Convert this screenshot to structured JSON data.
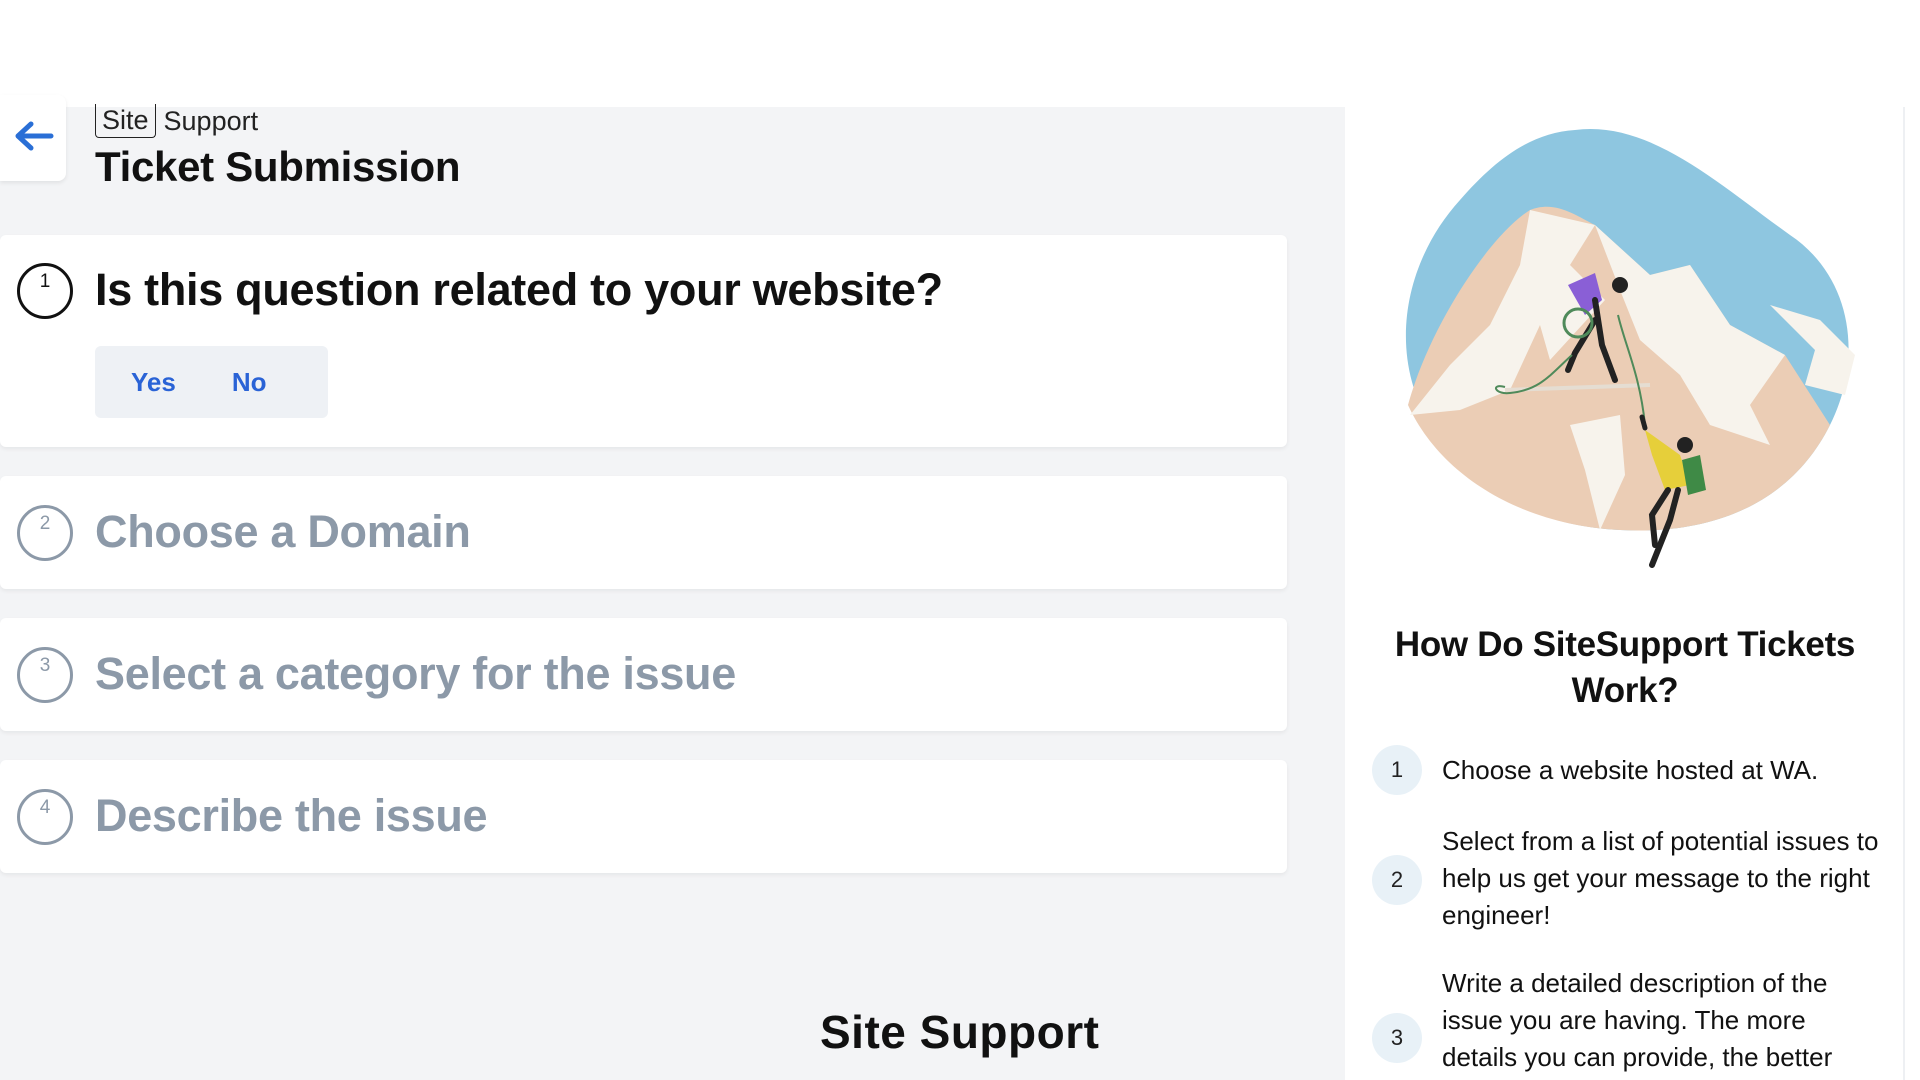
{
  "header": {
    "brand": "Site",
    "breadcrumb_suffix": "Support",
    "title": "Ticket Submission",
    "back_icon": "arrow-left-icon"
  },
  "steps": [
    {
      "number": "1",
      "title": "Is this question related to your website?",
      "active": true,
      "options": {
        "yes": "Yes",
        "no": "No"
      }
    },
    {
      "number": "2",
      "title": "Choose a Domain",
      "active": false
    },
    {
      "number": "3",
      "title": "Select a category for the issue",
      "active": false
    },
    {
      "number": "4",
      "title": "Describe the issue",
      "active": false
    }
  ],
  "footer": {
    "label": "Site Support"
  },
  "sidebar": {
    "illustration": "mountain-climbers-illustration",
    "title": "How Do SiteSupport Tickets Work?",
    "items": [
      {
        "number": "1",
        "text": "Choose a website hosted at WA."
      },
      {
        "number": "2",
        "text": "Select from a list of potential issues to help us get your message to the right engineer!"
      },
      {
        "number": "3",
        "text": "Write a detailed description of the issue you are having. The more details you can provide, the better"
      }
    ]
  },
  "colors": {
    "accent": "#2a63d6",
    "muted": "#8c99a8",
    "panel_bg": "#f3f4f6",
    "sky": "#8ec6e0",
    "rock": "#ebcdb5"
  }
}
